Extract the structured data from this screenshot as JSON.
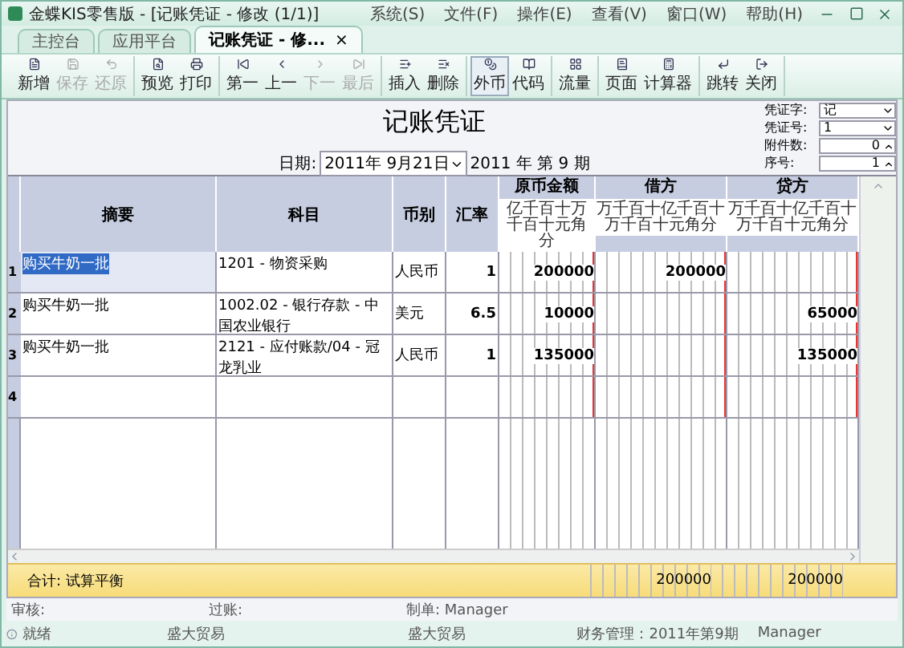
{
  "window": {
    "title": "金蝶KIS零售版 - [记账凭证 - 修改 (1/1)]"
  },
  "menu": [
    "系统(S)",
    "文件(F)",
    "操作(E)",
    "查看(V)",
    "窗口(W)",
    "帮助(H)"
  ],
  "tabs": [
    {
      "label": "主控台",
      "selected": false
    },
    {
      "label": "应用平台",
      "selected": false
    },
    {
      "label": "记账凭证 - 修...",
      "selected": true,
      "close": "×"
    }
  ],
  "toolbar": [
    {
      "label": "新增",
      "disabled": false,
      "pressed": false
    },
    {
      "label": "保存",
      "disabled": true,
      "pressed": false
    },
    {
      "label": "还原",
      "disabled": true,
      "pressed": false
    },
    {
      "label": "预览",
      "disabled": false,
      "pressed": false
    },
    {
      "label": "打印",
      "disabled": false,
      "pressed": false
    },
    {
      "label": "第一",
      "disabled": false,
      "pressed": false
    },
    {
      "label": "上一",
      "disabled": false,
      "pressed": false
    },
    {
      "label": "下一",
      "disabled": true,
      "pressed": false
    },
    {
      "label": "最后",
      "disabled": true,
      "pressed": false
    },
    {
      "label": "插入",
      "disabled": false,
      "pressed": false
    },
    {
      "label": "删除",
      "disabled": false,
      "pressed": false
    },
    {
      "label": "外币",
      "disabled": false,
      "pressed": true
    },
    {
      "label": "代码",
      "disabled": false,
      "pressed": false
    },
    {
      "label": "流量",
      "disabled": false,
      "pressed": false
    },
    {
      "label": "页面",
      "disabled": false,
      "pressed": false
    },
    {
      "label": "计算器",
      "disabled": false,
      "pressed": false
    },
    {
      "label": "跳转",
      "disabled": false,
      "pressed": false
    },
    {
      "label": "关闭",
      "disabled": false,
      "pressed": false
    }
  ],
  "voucher": {
    "title": "记账凭证",
    "date_label": "日期:",
    "date": "2011年 9月21日",
    "period": "2011 年 第 9 期",
    "fields": [
      {
        "label": "凭证字:",
        "value": "记",
        "kind": "dropdown"
      },
      {
        "label": "凭证号:",
        "value": "1",
        "kind": "dropdown"
      },
      {
        "label": "附件数:",
        "value": "0",
        "kind": "spinner"
      },
      {
        "label": "序号:",
        "value": "1",
        "kind": "spinner"
      }
    ]
  },
  "table": {
    "columns": [
      "摘要",
      "科目",
      "币别",
      "汇率",
      "原币金额",
      "借方",
      "贷方"
    ],
    "digit_headers": [
      "亿千百十万千百十元角分",
      "万千百十亿千百十万千百十元角分",
      "万千百十亿千百十万千百十元角分"
    ],
    "rows": [
      {
        "number": "1",
        "summary": "购买牛奶一批",
        "account": "1201 - 物资采购",
        "currency": "人民币",
        "rate": "1",
        "original": "200000",
        "debit": "200000",
        "selected": true
      },
      {
        "number": "2",
        "summary": "购买牛奶一批",
        "account": "1002.02 - 银行存款 - 中国农业银行",
        "currency": "美元",
        "rate": "6.5",
        "original": "10000",
        "credit": "65000",
        "selected": false
      },
      {
        "number": "3",
        "summary": "购买牛奶一批",
        "account": "2121 - 应付账款/04 - 冠龙乳业",
        "currency": "人民币",
        "rate": "1",
        "original": "135000",
        "credit": "135000",
        "selected": false
      },
      {
        "number": "4",
        "selected": false
      }
    ],
    "total": {
      "label": "合计:  试算平衡",
      "debit": "200000",
      "credit": "200000"
    }
  },
  "signatures": [
    {
      "label": "审核:"
    },
    {
      "label": "过账:"
    },
    {
      "label": "制单:",
      "value": "Manager"
    }
  ],
  "status_bar": [
    "就绪",
    "盛大贸易",
    "盛大贸易",
    "财务管理：2011年第9期",
    "Manager"
  ]
}
